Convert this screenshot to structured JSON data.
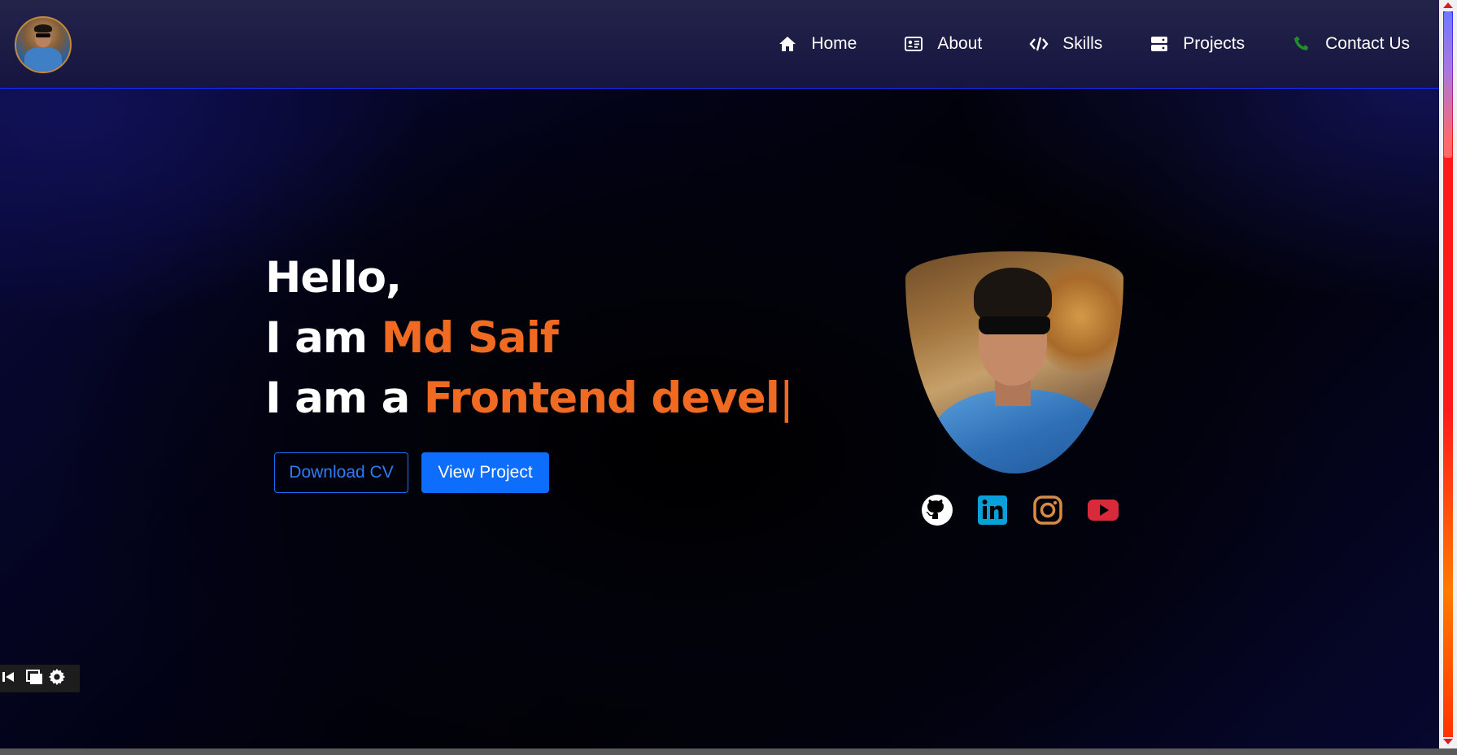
{
  "nav": {
    "items": [
      {
        "label": "Home",
        "icon": "home-icon"
      },
      {
        "label": "About",
        "icon": "id-card-icon"
      },
      {
        "label": "Skills",
        "icon": "code-icon"
      },
      {
        "label": "Projects",
        "icon": "server-icon"
      },
      {
        "label": "Contact Us",
        "icon": "phone-icon"
      }
    ]
  },
  "hero": {
    "greeting": "Hello,",
    "line2_prefix": "I am ",
    "name": "Md Saif",
    "line3_prefix": "I am a ",
    "role_typed": "Frontend devel",
    "cursor": "|"
  },
  "buttons": {
    "download": "Download CV",
    "view": "View Project"
  },
  "socials": [
    {
      "icon": "github-icon",
      "color": "#ffffff"
    },
    {
      "icon": "linkedin-icon",
      "color": "#0a9fd8"
    },
    {
      "icon": "instagram-icon",
      "color": "#d98a43"
    },
    {
      "icon": "youtube-icon",
      "color": "#d92a3c"
    }
  ],
  "colors": {
    "accent": "#f06a22",
    "primary_button": "#0d6efd",
    "nav_border": "#1a2cff",
    "phone_icon": "#1f8f2a"
  }
}
